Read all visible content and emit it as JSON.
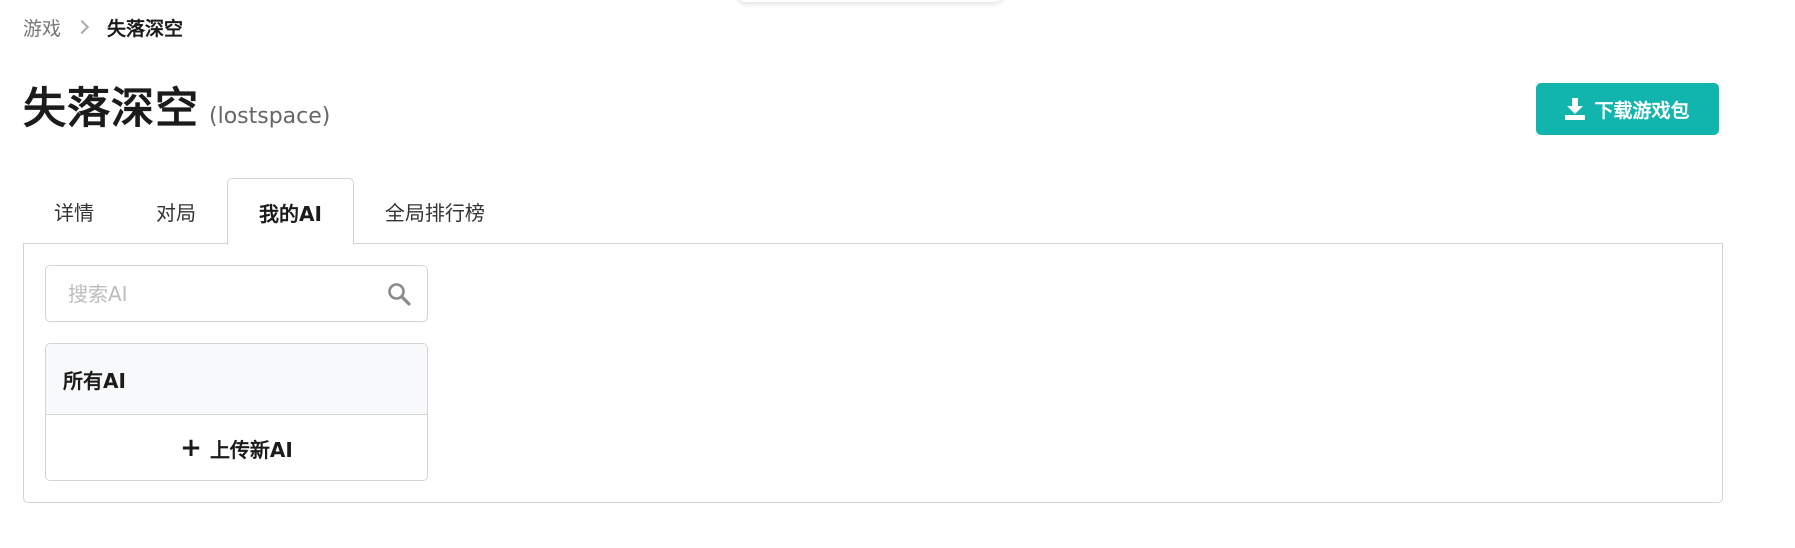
{
  "breadcrumb": {
    "parent": "游戏",
    "current": "失落深空"
  },
  "header": {
    "title": "失落深空",
    "subtitle": "(lostspace)",
    "download_label": "下载游戏包",
    "download_icon": "download-icon"
  },
  "tabs": [
    {
      "label": "详情",
      "active": false
    },
    {
      "label": "对局",
      "active": false
    },
    {
      "label": "我的AI",
      "active": true
    },
    {
      "label": "全局排行榜",
      "active": false
    }
  ],
  "search": {
    "placeholder": "搜索AI",
    "value": "",
    "icon": "search-icon"
  },
  "ai_list": {
    "header": "所有AI",
    "upload_label": "上传新AI",
    "upload_icon": "plus-icon"
  },
  "colors": {
    "accent": "#12b5ad",
    "border": "#d4d4d5"
  }
}
